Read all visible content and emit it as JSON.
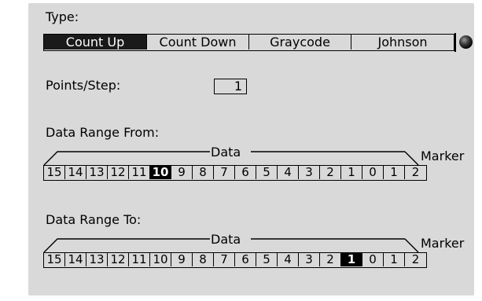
{
  "type_label": "Type:",
  "type_options": [
    "Count Up",
    "Count Down",
    "Graycode",
    "Johnson"
  ],
  "type_selected": "Count Up",
  "points_step": {
    "label": "Points/Step:",
    "value": "1"
  },
  "data_range_from": {
    "label": "Data Range From:",
    "data_label": "Data",
    "marker_label": "Marker",
    "bits": [
      "15",
      "14",
      "13",
      "12",
      "11",
      "10",
      "9",
      "8",
      "7",
      "6",
      "5",
      "4",
      "3",
      "2",
      "1",
      "0",
      "1",
      "2"
    ],
    "selected_bit": "10"
  },
  "data_range_to": {
    "label": "Data Range To:",
    "data_label": "Data",
    "marker_label": "Marker",
    "bits": [
      "15",
      "14",
      "13",
      "12",
      "11",
      "10",
      "9",
      "8",
      "7",
      "6",
      "5",
      "4",
      "3",
      "2",
      "1",
      "0",
      "1",
      "2"
    ],
    "selected_bit": "1"
  }
}
